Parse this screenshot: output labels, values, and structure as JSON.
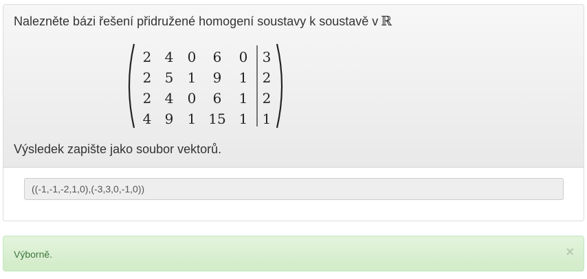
{
  "question": {
    "text": "Nalezněte bázi řešení přidružené homogení soustavy k soustavě v",
    "field_symbol": "ℝ"
  },
  "matrix": {
    "rows": [
      [
        "2",
        "4",
        "0",
        "6",
        "0",
        "3"
      ],
      [
        "2",
        "5",
        "1",
        "9",
        "1",
        "2"
      ],
      [
        "2",
        "4",
        "0",
        "6",
        "1",
        "2"
      ],
      [
        "4",
        "9",
        "1",
        "15",
        "1",
        "1"
      ]
    ]
  },
  "instruction": "Výsledek zapište jako soubor vektorů.",
  "answer": {
    "value": "((-1,-1,-2,1,0),(-3,3,0,-1,0))"
  },
  "feedback": {
    "message": "Výborně.",
    "close_symbol": "×",
    "color": "#3c763d"
  }
}
